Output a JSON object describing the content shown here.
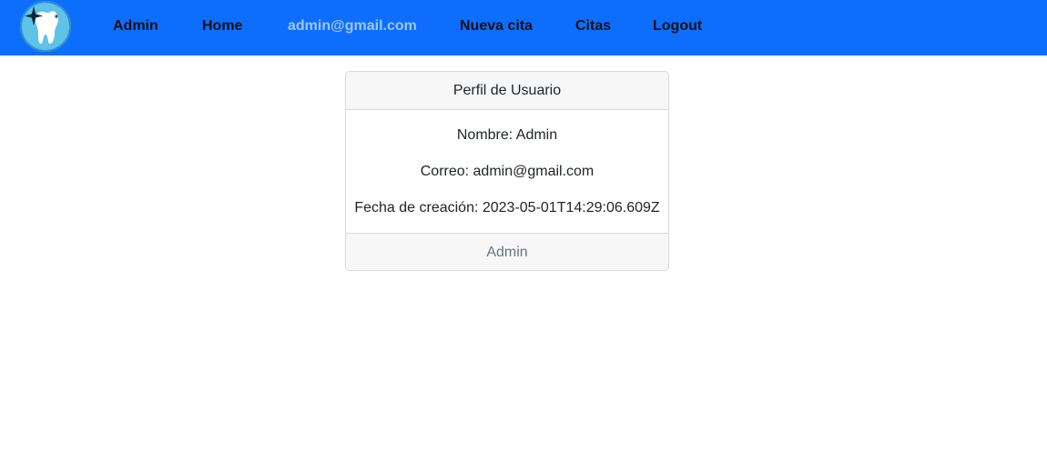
{
  "navbar": {
    "background": "#0d6efd",
    "logo_icon": "tooth-sparkle-icon",
    "links": [
      {
        "label": "Admin"
      },
      {
        "label": "Home"
      },
      {
        "label": "admin@gmail.com"
      },
      {
        "label": "Nueva cita"
      },
      {
        "label": "Citas"
      },
      {
        "label": "Logout"
      }
    ]
  },
  "profile_card": {
    "title": "Perfil de Usuario",
    "name": "Nombre: Admin",
    "email": "Correo: admin@gmail.com",
    "created": "Fecha de creación: 2023-05-01T14:29:06.609Z",
    "footer": "Admin"
  }
}
